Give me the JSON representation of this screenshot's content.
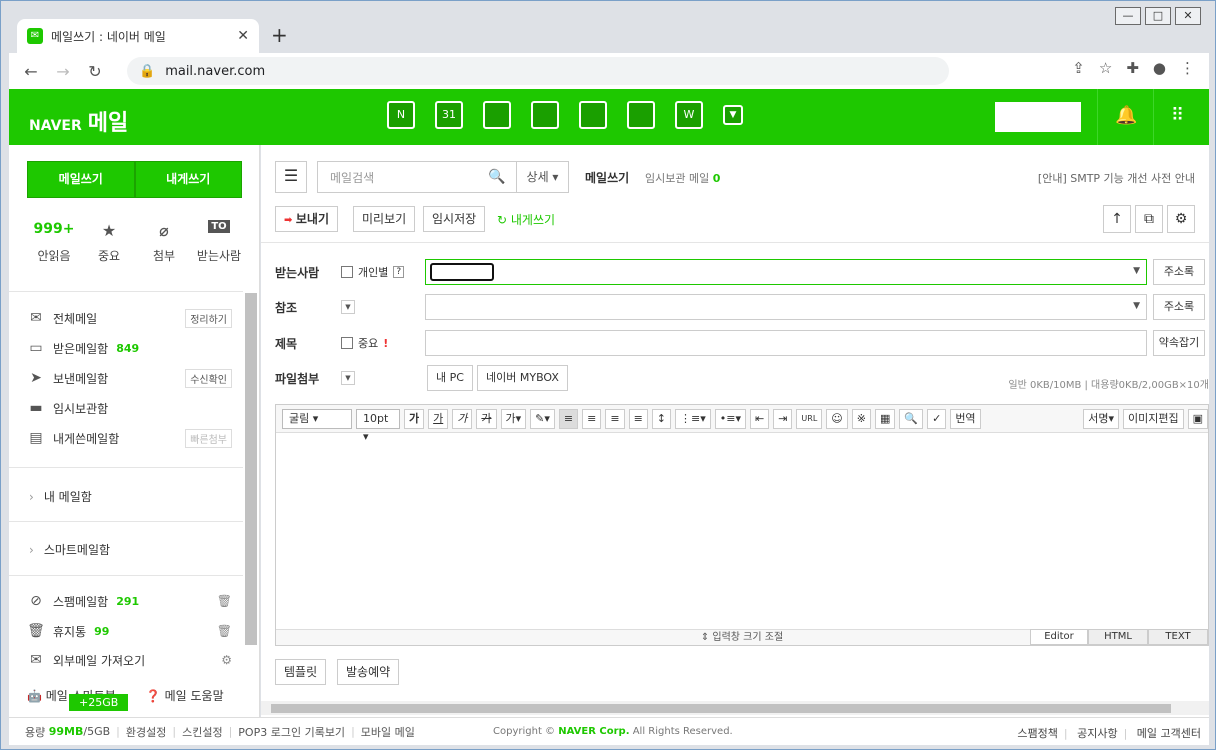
{
  "browser": {
    "tab_title": "메일쓰기 : 네이버 메일",
    "tab_close": "✕",
    "new_tab": "+",
    "url": "mail.naver.com"
  },
  "gnb": {
    "brand": "NAVER",
    "service": "메일",
    "app_labels": [
      "N",
      "31",
      "",
      "",
      "",
      "",
      "W",
      "▼"
    ]
  },
  "sidebar": {
    "write_button": "메일쓰기",
    "self_write_button": "내게쓰기",
    "quick": [
      {
        "top": "999+",
        "label": "안읽음"
      },
      {
        "top": "★",
        "label": "중요"
      },
      {
        "top": "⌀",
        "label": "첨부"
      },
      {
        "top": "TO",
        "label": "받는사람"
      }
    ],
    "mailboxes": [
      {
        "label": "전체메일",
        "count": "",
        "tag": "정리하기"
      },
      {
        "label": "받은메일함",
        "count": "849",
        "tag": ""
      },
      {
        "label": "보낸메일함",
        "count": "",
        "tag": "수신확인"
      },
      {
        "label": "임시보관함",
        "count": "",
        "tag": ""
      },
      {
        "label": "내게쓴메일함",
        "count": "",
        "tag": "빠른첨부"
      }
    ],
    "groups": [
      "내 메일함",
      "스마트메일함"
    ],
    "bottom_boxes": [
      {
        "label": "스팸메일함",
        "count": "291"
      },
      {
        "label": "휴지통",
        "count": "99"
      },
      {
        "label": "외부메일 가져오기",
        "count": ""
      }
    ],
    "bot_label": "메일 스마트봇",
    "help_label": "메일 도움말",
    "badge": "+25GB"
  },
  "compose": {
    "search_placeholder": "메일검색",
    "search_detail": "상세 ▾",
    "title": "메일쓰기",
    "temp_label": "임시보관 메일",
    "temp_count": "0",
    "notice": "[안내] SMTP 기능 개선 사전 안내",
    "send": "보내기",
    "preview": "미리보기",
    "save": "임시저장",
    "self": "↻ 내게쓰기",
    "to_label": "받는사람",
    "individual": "개인별",
    "help": "?",
    "address_book": "주소록",
    "cc_label": "참조",
    "subject_label": "제목",
    "important": "중요",
    "bang": "!",
    "signature": "약속잡기",
    "attach_label": "파일첨부",
    "my_pc": "내 PC",
    "mybox": "네이버 MYBOX",
    "capacity": "일반 0KB/10MB  |  대용량0KB/2,00GB×10개",
    "editor": {
      "font": "굴림 ▾",
      "size": "10pt ▾",
      "translate": "번역",
      "sign": "서명▾",
      "imgedit": "이미지편집",
      "resize": "⇕ 입력창 크기 조절",
      "modes": [
        "Editor",
        "HTML",
        "TEXT"
      ]
    },
    "template": "템플릿",
    "schedule": "발송예약"
  },
  "footer": {
    "usage_label": "용량",
    "usage": "99MB",
    "total": "/5GB",
    "links": [
      "환경설정",
      "스킨설정",
      "POP3 로그인 기록보기",
      "모바일 메일"
    ],
    "copyright_pre": "Copyright ©",
    "corp": "NAVER Corp.",
    "rights": "All Rights Reserved.",
    "right_links": [
      "스팸정책",
      "공지사항",
      "메일 고객센터"
    ]
  }
}
